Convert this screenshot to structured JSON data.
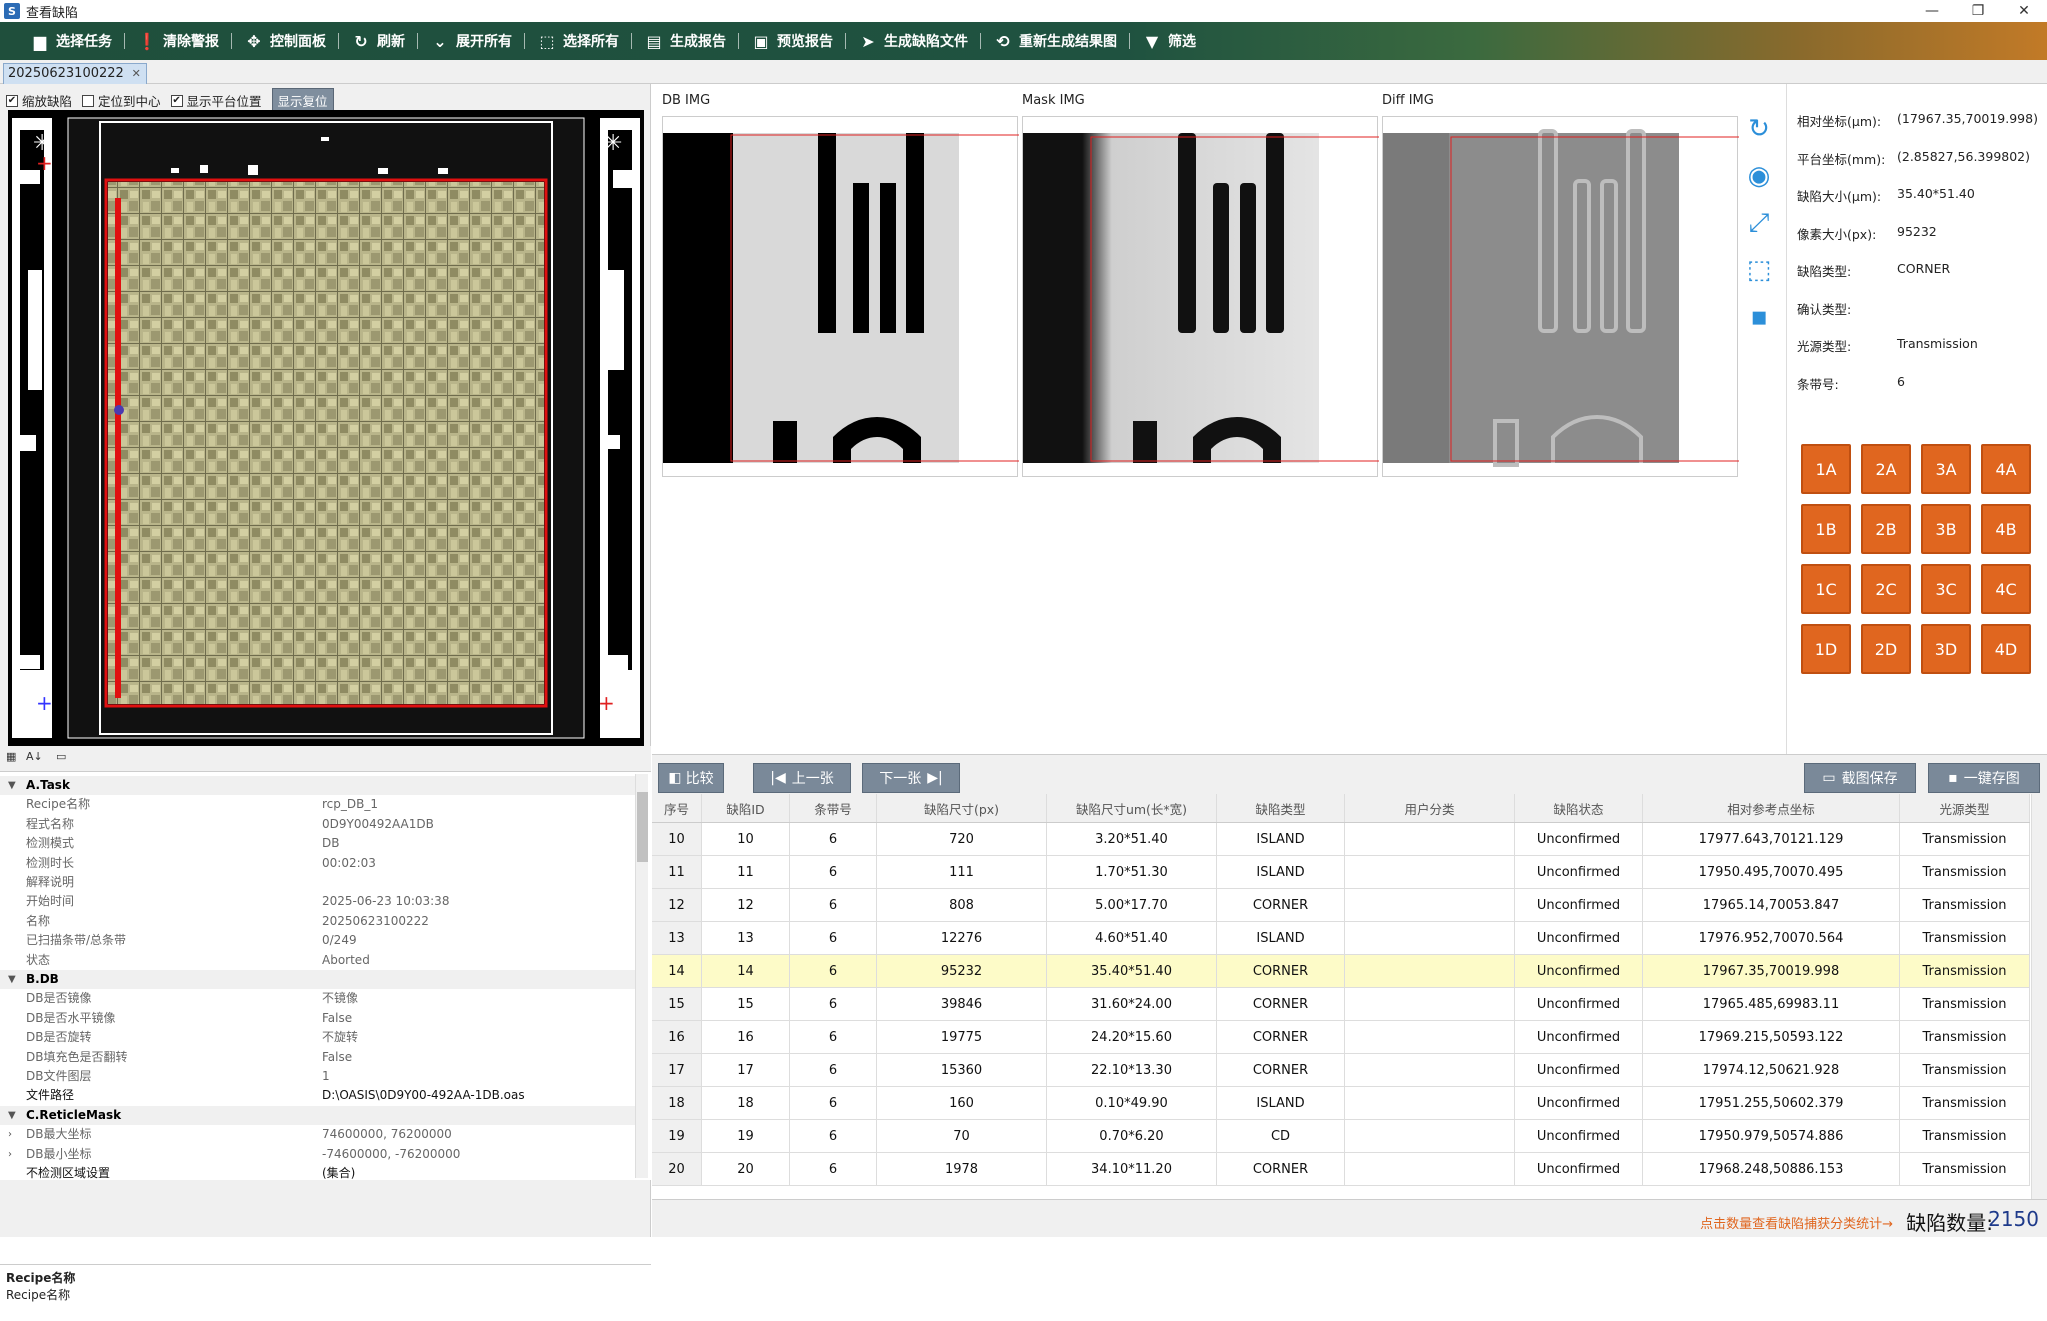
{
  "window": {
    "title": "查看缺陷",
    "minimize": "—",
    "restore": "❐",
    "close": "✕"
  },
  "toolbar": [
    {
      "label": "选择任务",
      "icon": "folder-icon",
      "glyph": "▆"
    },
    {
      "label": "清除警报",
      "icon": "alert-icon",
      "glyph": "❗"
    },
    {
      "label": "控制面板",
      "icon": "control-panel-icon",
      "glyph": "✥"
    },
    {
      "label": "刷新",
      "icon": "refresh-icon",
      "glyph": "↻"
    },
    {
      "label": "展开所有",
      "icon": "chevron-down-icon",
      "glyph": "⌄"
    },
    {
      "label": "选择所有",
      "icon": "select-all-icon",
      "glyph": "⬚"
    },
    {
      "label": "生成报告",
      "icon": "report-icon",
      "glyph": "▤"
    },
    {
      "label": "预览报告",
      "icon": "pdf-icon",
      "glyph": "▣"
    },
    {
      "label": "生成缺陷文件",
      "icon": "send-icon",
      "glyph": "➤"
    },
    {
      "label": "重新生成结果图",
      "icon": "image-regen-icon",
      "glyph": "⟲"
    },
    {
      "label": "筛选",
      "icon": "filter-icon",
      "glyph": "▼"
    }
  ],
  "tab": {
    "label": "20250623100222",
    "close": "✕"
  },
  "left": {
    "checks": [
      {
        "label": "缩放缺陷",
        "checked": true
      },
      {
        "label": "定位到中心",
        "checked": false
      },
      {
        "label": "显示平台位置",
        "checked": true
      }
    ],
    "reset": "显示复位"
  },
  "props": [
    {
      "type": "cat",
      "k": "A.Task"
    },
    {
      "k": "Recipe名称",
      "v": "rcp_DB_1"
    },
    {
      "k": "程式名称",
      "v": "0D9Y00492AA1DB"
    },
    {
      "k": "检测模式",
      "v": "DB"
    },
    {
      "k": "检测时长",
      "v": "00:02:03"
    },
    {
      "k": "解释说明",
      "v": ""
    },
    {
      "k": "开始时间",
      "v": "2025-06-23 10:03:38"
    },
    {
      "k": "名称",
      "v": "20250623100222"
    },
    {
      "k": "已扫描条带/总条带",
      "v": "0/249"
    },
    {
      "k": "状态",
      "v": "Aborted"
    },
    {
      "type": "cat",
      "k": "B.DB"
    },
    {
      "k": "DB是否镜像",
      "v": "不镜像"
    },
    {
      "k": "DB是否水平镜像",
      "v": "False"
    },
    {
      "k": "DB是否旋转",
      "v": "不旋转"
    },
    {
      "k": "DB填充色是否翻转",
      "v": "False"
    },
    {
      "k": "DB文件图层",
      "v": "1"
    },
    {
      "k": "文件路径",
      "v": "D:\\OASIS\\0D9Y00-492AA-1DB.oas",
      "dark": true
    },
    {
      "type": "cat",
      "k": "C.ReticleMask"
    },
    {
      "k": "DB最大坐标",
      "v": "74600000, 76200000",
      "exp": true
    },
    {
      "k": "DB最小坐标",
      "v": "-74600000, -76200000",
      "exp": true
    },
    {
      "k": "不检测区域设置",
      "v": "(集合)",
      "dark": true
    }
  ],
  "desc": {
    "title": "Recipe名称",
    "body": "Recipe名称"
  },
  "images": [
    {
      "label": "DB IMG"
    },
    {
      "label": "Mask IMG"
    },
    {
      "label": "Diff IMG"
    }
  ],
  "info": [
    {
      "k": "相对坐标(μm):",
      "v": "(17967.35,70019.998)"
    },
    {
      "k": "平台坐标(mm):",
      "v": "(2.85827,56.399802)"
    },
    {
      "k": "缺陷大小(μm):",
      "v": "35.40*51.40"
    },
    {
      "k": "像素大小(px):",
      "v": "95232"
    },
    {
      "k": "缺陷类型:",
      "v": "CORNER"
    },
    {
      "k": "确认类型:",
      "v": ""
    },
    {
      "k": "光源类型:",
      "v": "Transmission"
    },
    {
      "k": "条带号:",
      "v": "6"
    }
  ],
  "gridButtons": [
    "1A",
    "2A",
    "3A",
    "4A",
    "1B",
    "2B",
    "3B",
    "4B",
    "1C",
    "2C",
    "3C",
    "4C",
    "1D",
    "2D",
    "3D",
    "4D"
  ],
  "nav": {
    "compare": "比较",
    "prev": "上一张",
    "next": "下一张",
    "screenshot": "截图保存",
    "saveall": "一键存图"
  },
  "table": {
    "headers": [
      "序号",
      "缺陷ID",
      "条带号",
      "缺陷尺寸(px)",
      "缺陷尺寸um(长*宽)",
      "缺陷类型",
      "用户分类",
      "缺陷状态",
      "相对参考点坐标",
      "光源类型"
    ],
    "rows": [
      [
        "10",
        "10",
        "6",
        "720",
        "3.20*51.40",
        "ISLAND",
        "",
        "Unconfirmed",
        "17977.643,70121.129",
        "Transmission"
      ],
      [
        "11",
        "11",
        "6",
        "111",
        "1.70*51.30",
        "ISLAND",
        "",
        "Unconfirmed",
        "17950.495,70070.495",
        "Transmission"
      ],
      [
        "12",
        "12",
        "6",
        "808",
        "5.00*17.70",
        "CORNER",
        "",
        "Unconfirmed",
        "17965.14,70053.847",
        "Transmission"
      ],
      [
        "13",
        "13",
        "6",
        "12276",
        "4.60*51.40",
        "ISLAND",
        "",
        "Unconfirmed",
        "17976.952,70070.564",
        "Transmission"
      ],
      [
        "14",
        "14",
        "6",
        "95232",
        "35.40*51.40",
        "CORNER",
        "",
        "Unconfirmed",
        "17967.35,70019.998",
        "Transmission"
      ],
      [
        "15",
        "15",
        "6",
        "39846",
        "31.60*24.00",
        "CORNER",
        "",
        "Unconfirmed",
        "17965.485,69983.11",
        "Transmission"
      ],
      [
        "16",
        "16",
        "6",
        "19775",
        "24.20*15.60",
        "CORNER",
        "",
        "Unconfirmed",
        "17969.215,50593.122",
        "Transmission"
      ],
      [
        "17",
        "17",
        "6",
        "15360",
        "22.10*13.30",
        "CORNER",
        "",
        "Unconfirmed",
        "17974.12,50621.928",
        "Transmission"
      ],
      [
        "18",
        "18",
        "6",
        "160",
        "0.10*49.90",
        "ISLAND",
        "",
        "Unconfirmed",
        "17951.255,50602.379",
        "Transmission"
      ],
      [
        "19",
        "19",
        "6",
        "70",
        "0.70*6.20",
        "CD",
        "",
        "Unconfirmed",
        "17950.979,50574.886",
        "Transmission"
      ],
      [
        "20",
        "20",
        "6",
        "1978",
        "34.10*11.20",
        "CORNER",
        "",
        "Unconfirmed",
        "17968.248,50886.153",
        "Transmission"
      ]
    ],
    "selected": 4
  },
  "footer": {
    "hint": "点击数量查看缺陷捕获分类统计→",
    "label": "缺陷数量:",
    "count": "2150"
  }
}
